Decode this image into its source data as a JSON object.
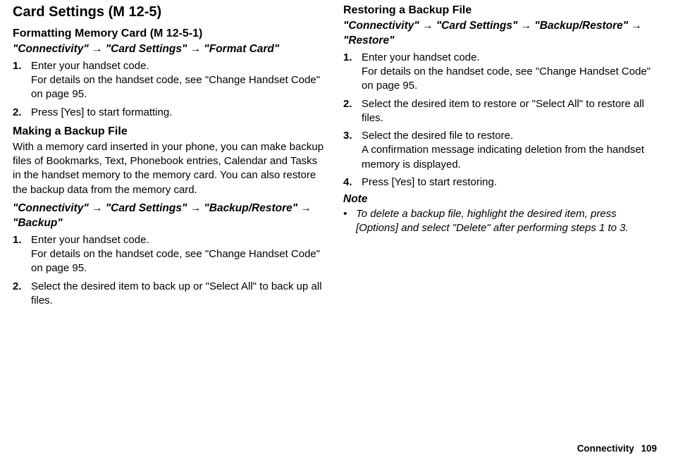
{
  "left": {
    "heading": "Card Settings",
    "heading_code": "(M 12-5)",
    "sec1": {
      "title": "Formatting Memory Card",
      "code": "(M 12-5-1)",
      "path": "\"Connectivity\" → \"Card Settings\" → \"Format Card\"",
      "steps": [
        {
          "main": "Enter your handset code.",
          "detail": "For details on the handset code, see \"Change Handset Code\" on page 95."
        },
        {
          "main": "Press [Yes] to start formatting."
        }
      ]
    },
    "sec2": {
      "title": "Making a Backup File",
      "intro": "With a memory card inserted in your phone, you can make backup files of Bookmarks, Text, Phonebook entries, Calendar and Tasks in the handset memory to the memory card. You can also restore the backup data from the memory card.",
      "path": "\"Connectivity\" → \"Card Settings\" → \"Backup/Restore\" → \"Backup\"",
      "steps": [
        {
          "main": "Enter your handset code.",
          "detail": "For details on the handset code, see \"Change Handset Code\" on page 95."
        },
        {
          "main": "Select the desired item to back up or \"Select All\" to back up all files."
        }
      ]
    }
  },
  "right": {
    "sec1": {
      "title": "Restoring a Backup File",
      "path": "\"Connectivity\" → \"Card Settings\" → \"Backup/Restore\" → \"Restore\"",
      "steps": [
        {
          "main": "Enter your handset code.",
          "detail": "For details on the handset code, see \"Change Handset Code\" on page 95."
        },
        {
          "main": "Select the desired item to restore or \"Select All\" to restore all files."
        },
        {
          "main": "Select the desired file to restore.",
          "detail": "A confirmation message indicating deletion from the handset memory is displayed."
        },
        {
          "main": "Press [Yes] to start restoring."
        }
      ]
    },
    "note_label": "Note",
    "note_text": "To delete a backup file, highlight the desired item, press [Options] and select \"Delete\" after performing steps 1 to 3."
  },
  "footer": {
    "section": "Connectivity",
    "page": "109"
  }
}
